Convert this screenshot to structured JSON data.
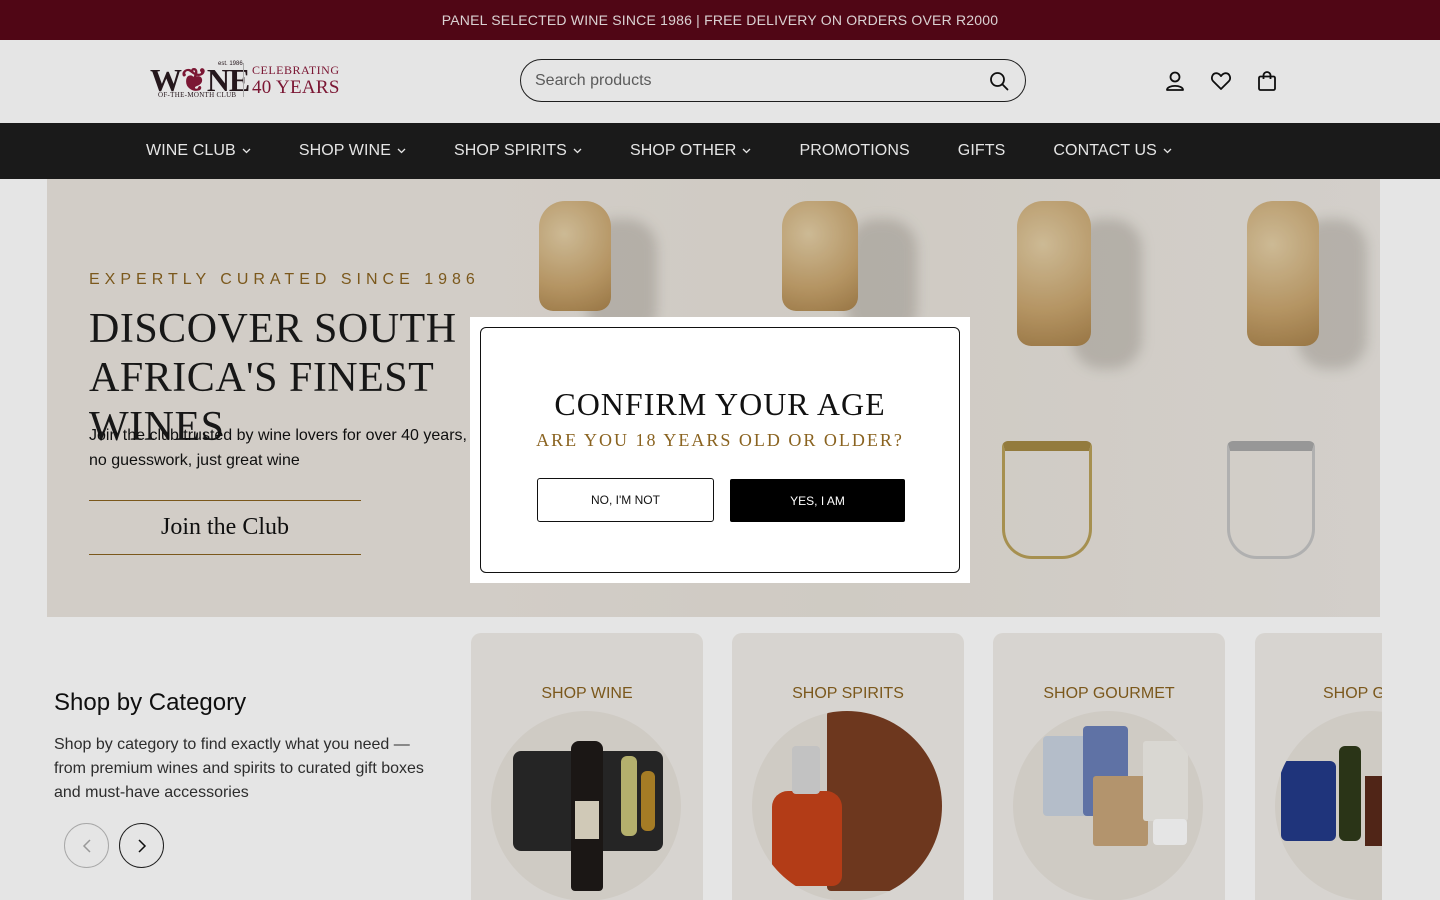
{
  "announcement": {
    "text": "PANEL SELECTED WINE SINCE 1986 | FREE DELIVERY ON ORDERS OVER R2000"
  },
  "header": {
    "logo": {
      "wordmark_pre": "W",
      "wordmark_post": "NE",
      "est": "est. 1986",
      "subline": "OF-THE-MONTH CLUB",
      "celebrating": "CELEBRATING",
      "years": "40 YEARS",
      "color": "#8a1a3a"
    },
    "search": {
      "placeholder": "Search products",
      "value": "",
      "icon": "search-icon"
    },
    "icons": [
      "account-icon",
      "wishlist-heart-icon",
      "cart-bag-icon"
    ]
  },
  "nav": {
    "items": [
      {
        "label": "WINE CLUB",
        "dropdown": true
      },
      {
        "label": "SHOP WINE",
        "dropdown": true
      },
      {
        "label": "SHOP SPIRITS",
        "dropdown": true
      },
      {
        "label": "SHOP OTHER",
        "dropdown": true
      },
      {
        "label": "PROMOTIONS",
        "dropdown": false
      },
      {
        "label": "GIFTS",
        "dropdown": false
      },
      {
        "label": "CONTACT US",
        "dropdown": true
      }
    ]
  },
  "hero": {
    "eyebrow": "EXPERTLY CURATED SINCE 1986",
    "title": "DISCOVER SOUTH AFRICA'S FINEST WINES",
    "body": "Join the club trusted by wine lovers for over 40 years, no guesswork, just great wine",
    "cta": "Join the Club"
  },
  "categories": {
    "title": "Shop by Category",
    "description": "Shop by category to find exactly what you need — from premium wines and spirits to curated gift boxes and must-have accessories",
    "cards": [
      {
        "label": "SHOP WINE"
      },
      {
        "label": "SHOP SPIRITS"
      },
      {
        "label": "SHOP GOURMET"
      },
      {
        "label": "SHOP G"
      }
    ]
  },
  "age_modal": {
    "title": "CONFIRM YOUR AGE",
    "question": "ARE YOU 18 YEARS OLD OR OLDER?",
    "no_label": "NO, I'M NOT",
    "yes_label": "YES, I AM"
  },
  "colors": {
    "announcement_bg": "#5a0718",
    "nav_bg": "#1e1e1e",
    "accent_gold": "#8a6320",
    "hero_bg": "#eae5de"
  }
}
